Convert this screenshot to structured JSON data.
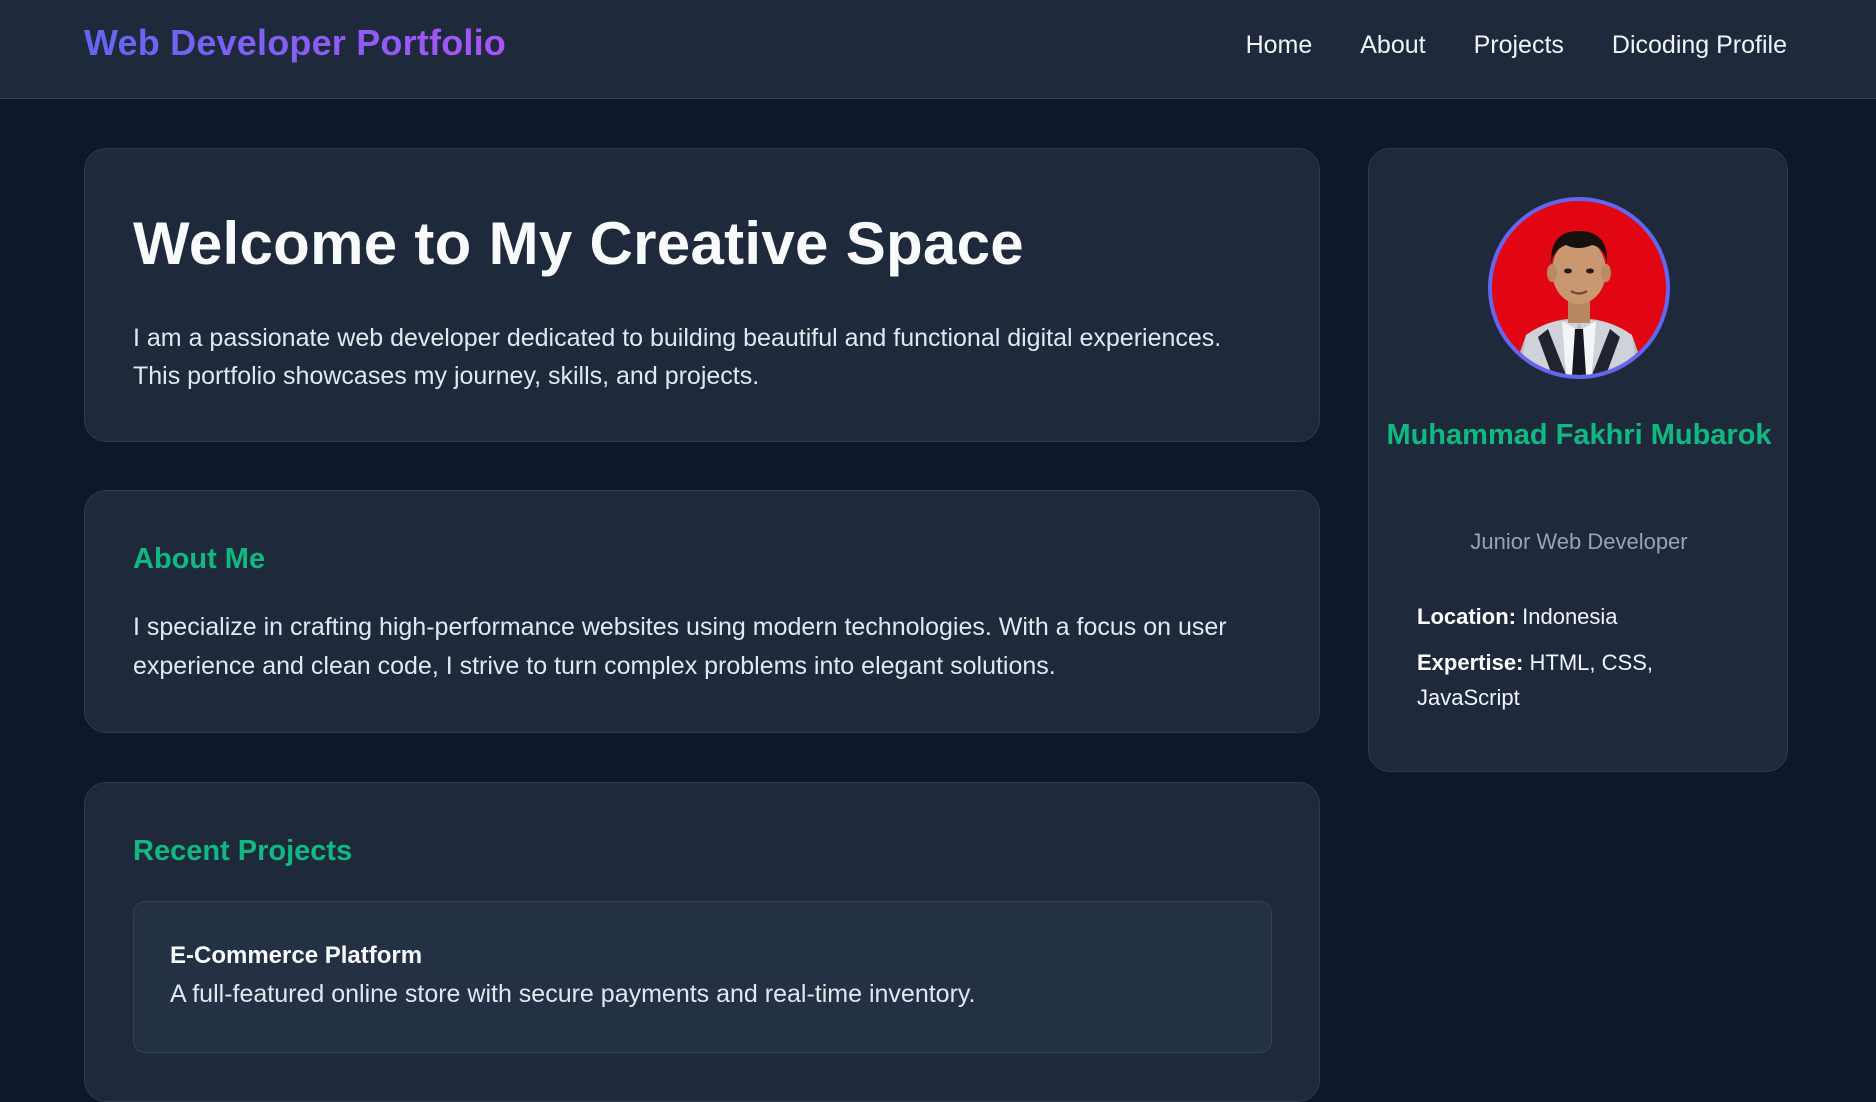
{
  "header": {
    "brand": "Web Developer Portfolio",
    "nav": [
      "Home",
      "About",
      "Projects",
      "Dicoding Profile"
    ]
  },
  "hero": {
    "title": "Welcome to My Creative Space",
    "text": "I am a passionate web developer dedicated to building beautiful and functional digital experiences. This portfolio showcases my journey, skills, and projects."
  },
  "about": {
    "title": "About Me",
    "text": "I specialize in crafting high-performance websites using modern technologies. With a focus on user experience and clean code, I strive to turn complex problems into elegant solutions."
  },
  "projects": {
    "title": "Recent Projects",
    "items": [
      {
        "name": "E-Commerce Platform",
        "description": "A full-featured online store with secure payments and real-time inventory."
      }
    ]
  },
  "profile": {
    "name": "Muhammad Fakhri Mubarok",
    "role": "Junior Web Developer",
    "location_label": "Location:",
    "location": "Indonesia",
    "expertise_label": "Expertise:",
    "expertise": "HTML, CSS, JavaScript"
  },
  "colors": {
    "background": "#0f172a",
    "surface": "#1e293b",
    "accent_green": "#10b981",
    "accent_indigo": "#6366f1",
    "avatar_background": "#e10612"
  }
}
